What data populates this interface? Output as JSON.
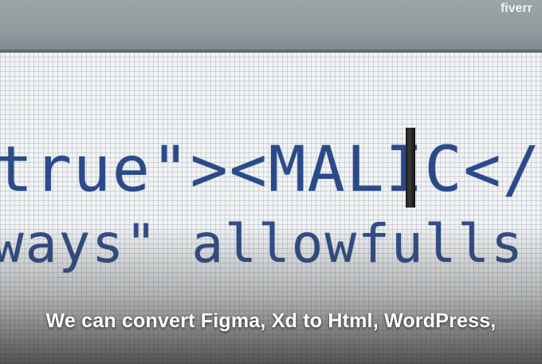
{
  "watermark": "fiverr",
  "code": {
    "line1": "true\"><MALIC</pa",
    "line2": "ways\" allowfulls"
  },
  "caption": "We can convert Figma, Xd to Html, WordPress,"
}
